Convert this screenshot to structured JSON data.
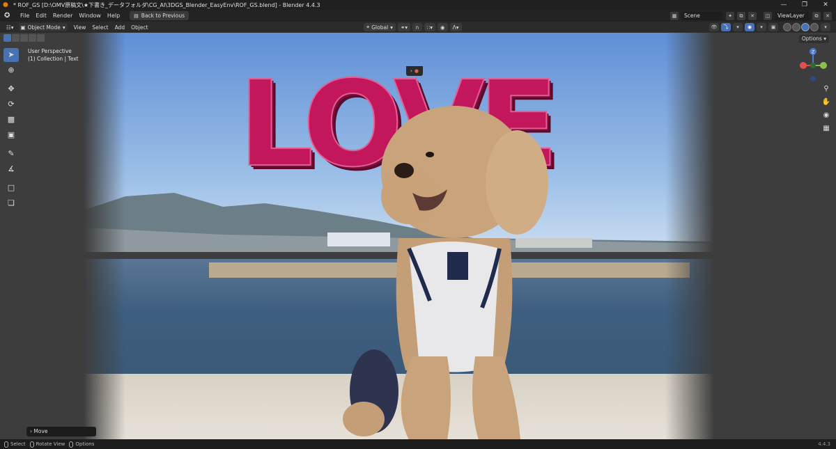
{
  "titlebar": {
    "title": "* ROF_GS [D:\\OMV原稿文\\★下書き_データフォルダ\\CG_AI\\3DGS_Blender_EasyEnv\\ROF_GS.blend] - Blender 4.4.3",
    "min": "—",
    "max": "❐",
    "close": "✕"
  },
  "menubar": {
    "items": [
      "File",
      "Edit",
      "Render",
      "Window",
      "Help"
    ],
    "back_label": "Back to Previous",
    "scene_label": "Scene",
    "viewlayer_label": "ViewLayer"
  },
  "viewport_header": {
    "mode": "Object Mode",
    "menus": [
      "View",
      "Select",
      "Add",
      "Object"
    ],
    "orientation": "Global"
  },
  "viewport": {
    "view_name": "User Perspective",
    "collection_path": "(1) Collection | Text",
    "options_label": "Options",
    "scene_text": "LOVE",
    "gizmo_axes": {
      "z": "Z",
      "y": "Y",
      "x": "X"
    }
  },
  "panels": {
    "last_op": "Move"
  },
  "statusbar": {
    "select": "Select",
    "rotate": "Rotate View",
    "options": "Options",
    "version": "4.4.3"
  },
  "colors": {
    "accent": "#4772b3",
    "love_text": "#c2185b"
  }
}
